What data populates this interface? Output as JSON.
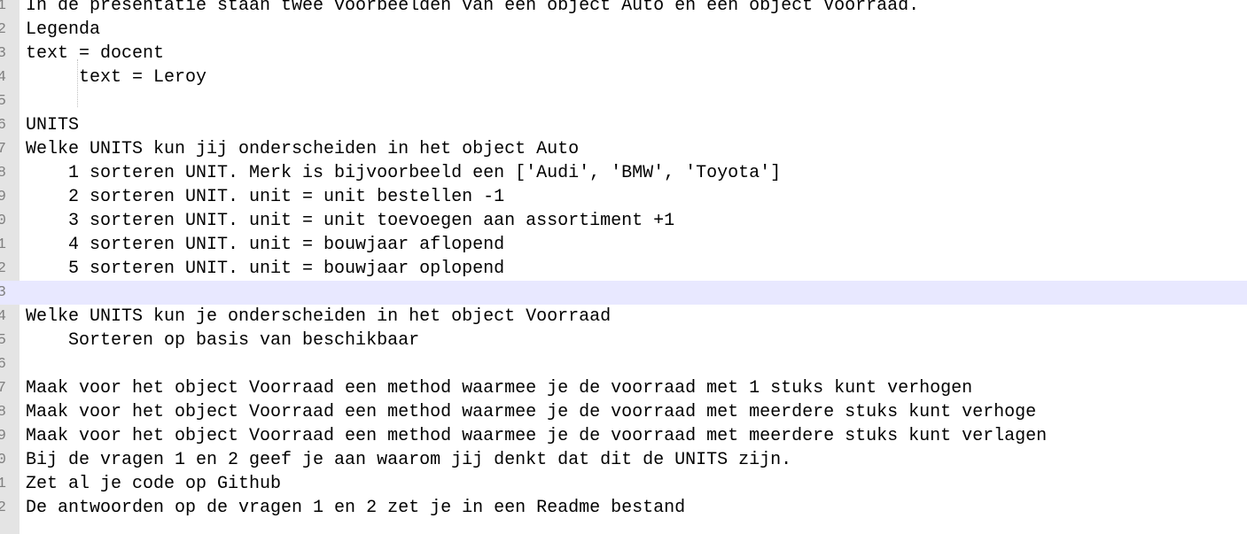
{
  "editor": {
    "current_line_index": 12,
    "lines": [
      {
        "num": "1",
        "text": "In de presentatie staan twee voorbeelden van een object Auto en een object Voorraad."
      },
      {
        "num": "2",
        "text": "Legenda"
      },
      {
        "num": "3",
        "text": "text = docent"
      },
      {
        "num": "4",
        "text": "     text = Leroy"
      },
      {
        "num": "5",
        "text": ""
      },
      {
        "num": "6",
        "text": "UNITS"
      },
      {
        "num": "7",
        "text": "Welke UNITS kun jij onderscheiden in het object Auto"
      },
      {
        "num": "8",
        "text": "    1 sorteren UNIT. Merk is bijvoorbeeld een ['Audi', 'BMW', 'Toyota']"
      },
      {
        "num": "9",
        "text": "    2 sorteren UNIT. unit = unit bestellen -1"
      },
      {
        "num": "0",
        "text": "    3 sorteren UNIT. unit = unit toevoegen aan assortiment +1"
      },
      {
        "num": "1",
        "text": "    4 sorteren UNIT. unit = bouwjaar aflopend"
      },
      {
        "num": "2",
        "text": "    5 sorteren UNIT. unit = bouwjaar oplopend"
      },
      {
        "num": "3",
        "text": ""
      },
      {
        "num": "4",
        "text": "Welke UNITS kun je onderscheiden in het object Voorraad"
      },
      {
        "num": "5",
        "text": "    Sorteren op basis van beschikbaar"
      },
      {
        "num": "6",
        "text": ""
      },
      {
        "num": "7",
        "text": "Maak voor het object Voorraad een method waarmee je de voorraad met 1 stuks kunt verhogen"
      },
      {
        "num": "8",
        "text": "Maak voor het object Voorraad een method waarmee je de voorraad met meerdere stuks kunt verhoge"
      },
      {
        "num": "9",
        "text": "Maak voor het object Voorraad een method waarmee je de voorraad met meerdere stuks kunt verlagen"
      },
      {
        "num": "0",
        "text": "Bij de vragen 1 en 2 geef je aan waarom jij denkt dat dit de UNITS zijn."
      },
      {
        "num": "1",
        "text": "Zet al je code op Github"
      },
      {
        "num": "2",
        "text": "De antwoorden op de vragen 1 en 2 zet je in een Readme bestand"
      }
    ]
  }
}
